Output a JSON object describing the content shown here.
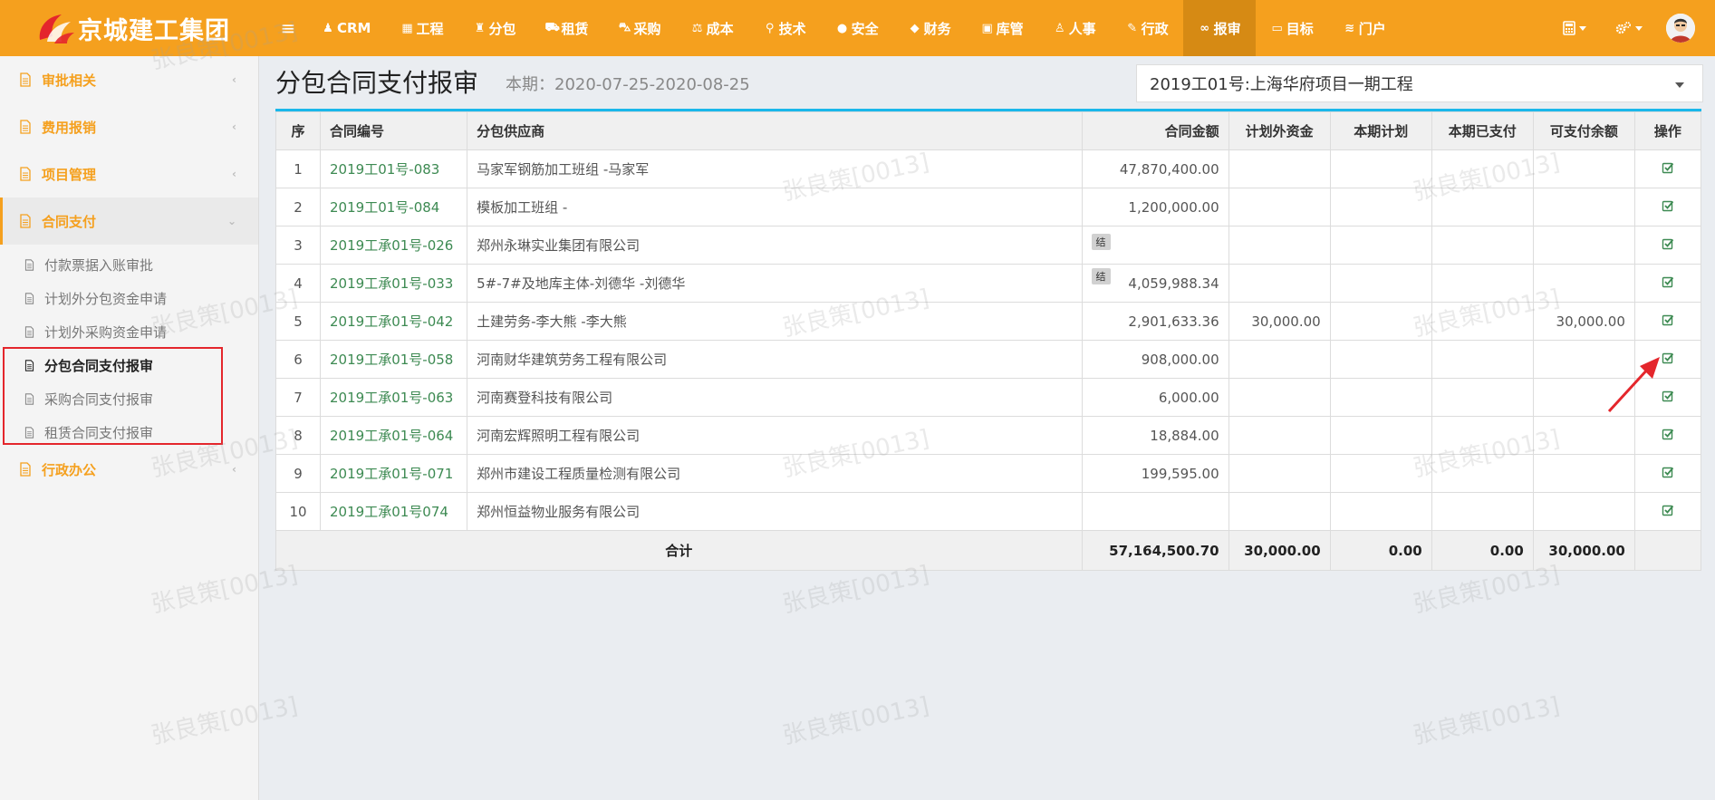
{
  "brand": {
    "name": "京城建工集团"
  },
  "nav": {
    "toggle": "≡",
    "items": [
      {
        "label": "CRM",
        "icon": "user-icon",
        "glyph": "♟"
      },
      {
        "label": "工程",
        "icon": "building-icon",
        "glyph": "▦"
      },
      {
        "label": "分包",
        "icon": "users-icon",
        "glyph": "♜"
      },
      {
        "label": "租赁",
        "icon": "car-icon",
        "glyph": "⛟"
      },
      {
        "label": "采购",
        "icon": "truck-icon",
        "glyph": "⛍"
      },
      {
        "label": "成本",
        "icon": "balance-icon",
        "glyph": "⚖"
      },
      {
        "label": "技术",
        "icon": "wrench-icon",
        "glyph": "⚲"
      },
      {
        "label": "安全",
        "icon": "shield-icon",
        "glyph": "●"
      },
      {
        "label": "财务",
        "icon": "diamond-icon",
        "glyph": "◆"
      },
      {
        "label": "库管",
        "icon": "box-icon",
        "glyph": "▣"
      },
      {
        "label": "人事",
        "icon": "person-icon",
        "glyph": "♙"
      },
      {
        "label": "行政",
        "icon": "edit-icon",
        "glyph": "✎"
      },
      {
        "label": "报审",
        "icon": "link-icon",
        "glyph": "∞"
      },
      {
        "label": "目标",
        "icon": "monitor-icon",
        "glyph": "▭"
      },
      {
        "label": "门户",
        "icon": "rss-icon",
        "glyph": "≋"
      }
    ],
    "active_index": 12
  },
  "topright": {
    "calc_icon": "calculator-icon",
    "settings_icon": "gears-icon",
    "avatar_icon": "avatar-icon"
  },
  "sidebar": {
    "groups": [
      {
        "label": "审批相关",
        "icon": "file-icon"
      },
      {
        "label": "费用报销",
        "icon": "file-icon"
      },
      {
        "label": "项目管理",
        "icon": "file-icon"
      }
    ],
    "open_group": {
      "label": "合同支付",
      "icon": "file-icon"
    },
    "sub_items": [
      {
        "label": "付款票据入账审批"
      },
      {
        "label": "计划外分包资金申请"
      },
      {
        "label": "计划外采购资金申请"
      },
      {
        "label": "分包合同支付报审"
      },
      {
        "label": "采购合同支付报审"
      },
      {
        "label": "租赁合同支付报审"
      }
    ],
    "active_sub_index": 3,
    "last_group": {
      "label": "行政办公",
      "icon": "file-icon"
    }
  },
  "page": {
    "title": "分包合同支付报审",
    "period": "本期：2020-07-25-2020-08-25",
    "project": "2019工01号:上海华府项目一期工程"
  },
  "table": {
    "headers": [
      "序",
      "合同编号",
      "分包供应商",
      "合同金额",
      "计划外资金",
      "本期计划",
      "本期已支付",
      "可支付余额",
      "操作"
    ],
    "rows": [
      {
        "seq": "1",
        "no": "2019工01号-083",
        "supplier": "马家军钢筋加工班组 -马家军",
        "tag": "",
        "amount": "47,870,400.00",
        "outplan": "",
        "plan": "",
        "paid": "",
        "balance": ""
      },
      {
        "seq": "2",
        "no": "2019工01号-084",
        "supplier": "模板加工班组 -",
        "tag": "",
        "amount": "1,200,000.00",
        "outplan": "",
        "plan": "",
        "paid": "",
        "balance": ""
      },
      {
        "seq": "3",
        "no": "2019工承01号-026",
        "supplier": "郑州永琳实业集团有限公司",
        "tag": "结",
        "amount": "",
        "outplan": "",
        "plan": "",
        "paid": "",
        "balance": ""
      },
      {
        "seq": "4",
        "no": "2019工承01号-033",
        "supplier": "5#-7#及地库主体-刘德华 -刘德华",
        "tag": "结",
        "amount": "4,059,988.34",
        "outplan": "",
        "plan": "",
        "paid": "",
        "balance": ""
      },
      {
        "seq": "5",
        "no": "2019工承01号-042",
        "supplier": "土建劳务-李大熊 -李大熊",
        "tag": "",
        "amount": "2,901,633.36",
        "outplan": "30,000.00",
        "plan": "",
        "paid": "",
        "balance": "30,000.00"
      },
      {
        "seq": "6",
        "no": "2019工承01号-058",
        "supplier": "河南财华建筑劳务工程有限公司",
        "tag": "",
        "amount": "908,000.00",
        "outplan": "",
        "plan": "",
        "paid": "",
        "balance": ""
      },
      {
        "seq": "7",
        "no": "2019工承01号-063",
        "supplier": "河南赛登科技有限公司",
        "tag": "",
        "amount": "6,000.00",
        "outplan": "",
        "plan": "",
        "paid": "",
        "balance": ""
      },
      {
        "seq": "8",
        "no": "2019工承01号-064",
        "supplier": "河南宏辉照明工程有限公司",
        "tag": "",
        "amount": "18,884.00",
        "outplan": "",
        "plan": "",
        "paid": "",
        "balance": ""
      },
      {
        "seq": "9",
        "no": "2019工承01号-071",
        "supplier": "郑州市建设工程质量检测有限公司",
        "tag": "",
        "amount": "199,595.00",
        "outplan": "",
        "plan": "",
        "paid": "",
        "balance": ""
      },
      {
        "seq": "10",
        "no": "2019工承01号074",
        "supplier": "郑州恒益物业服务有限公司",
        "tag": "",
        "amount": "",
        "outplan": "",
        "plan": "",
        "paid": "",
        "balance": ""
      }
    ],
    "total": {
      "label": "合计",
      "amount": "57,164,500.70",
      "outplan": "30,000.00",
      "plan": "0.00",
      "paid": "0.00",
      "balance": "30,000.00"
    }
  },
  "watermark": "张良策[0013]",
  "colors": {
    "accent": "#f5a01e",
    "link": "#3d8a52",
    "table_top": "#1ab7ea",
    "highlight": "#e4262c"
  }
}
